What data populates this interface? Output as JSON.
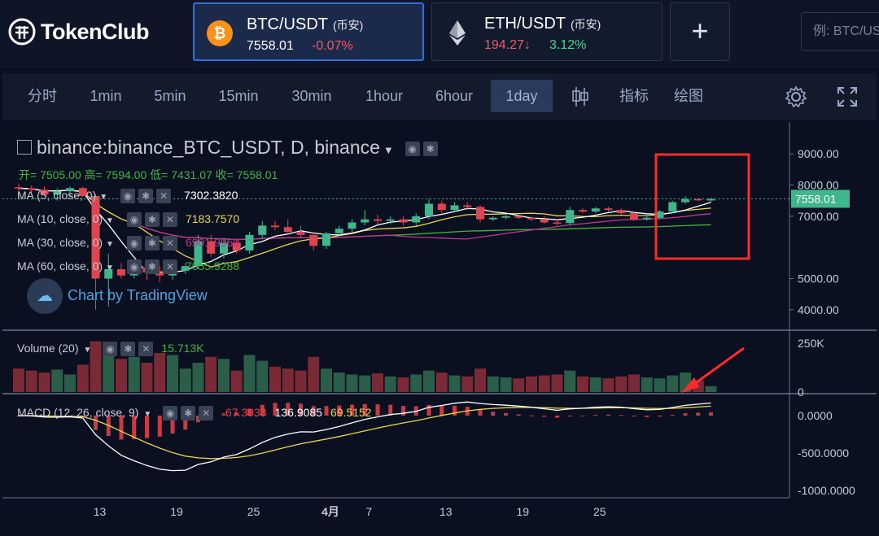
{
  "brand": {
    "name": "TokenClub"
  },
  "pairs": [
    {
      "name": "BTC/USDT",
      "exchange": "(币安)",
      "price": "7558.01",
      "change": "-0.07%",
      "change_color": "#f05a61",
      "coin_color": "#f7931a"
    },
    {
      "name": "ETH/USDT",
      "exchange": "(币安)",
      "price": "194.27↓",
      "change": "3.12%",
      "price_color": "#f05a61",
      "change_color": "#3ddc84"
    }
  ],
  "add_label": "+",
  "search": {
    "placeholder": "例: BTC/US"
  },
  "toolbar": {
    "items": [
      "分时",
      "1min",
      "5min",
      "15min",
      "30min",
      "1hour",
      "6hour",
      "1day"
    ],
    "active": "1day",
    "indicators": "指标",
    "draw": "绘图"
  },
  "legend": {
    "symbol": "binance:binance_BTC_USDT, D, binance",
    "ohlc": "开= 7505.00 高= 7594.00 低= 7431.07 收= 7558.01",
    "ma5": {
      "label": "MA (5, close, 0)",
      "value": "7302.3820",
      "color": "#ffffff"
    },
    "ma10": {
      "label": "MA (10, close, 0)",
      "value": "7183.7570",
      "color": "#e8d44d"
    },
    "ma30": {
      "label": "MA (30, close, 0)",
      "value": "6901.9960",
      "color": "#c2348f"
    },
    "ma60": {
      "label": "MA (60, close, 0)",
      "value": "7055.9288",
      "color": "#3fb53f"
    },
    "watermark": "Chart by TradingView",
    "volume": {
      "label": "Volume (20)",
      "value": "15.713K"
    },
    "macd": {
      "label": "MACD (12, 26, close, 9)",
      "hist": "-67.3933",
      "macd": "136.9085",
      "signal": "69.5152"
    }
  },
  "price_axis": [
    "9000.00",
    "8000.00",
    "7000.00",
    "5000.00",
    "4000.00"
  ],
  "price_marker": "7558.01",
  "volume_axis": [
    "250K",
    "0"
  ],
  "macd_axis": [
    "0.0000",
    "-500.0000",
    "-1000.0000"
  ],
  "time_axis": [
    "13",
    "19",
    "25",
    "4月",
    "7",
    "13",
    "19",
    "25"
  ],
  "colors": {
    "up": "#3fb68b",
    "down": "#e0454f",
    "highlight": "#ff2a2a"
  },
  "chart_data": {
    "type": "candlestick",
    "candles": [
      {
        "o": 7930,
        "h": 8050,
        "l": 7700,
        "c": 7900
      },
      {
        "o": 7900,
        "h": 7990,
        "l": 7750,
        "c": 7850
      },
      {
        "o": 7850,
        "h": 7950,
        "l": 7650,
        "c": 7700
      },
      {
        "o": 7700,
        "h": 7900,
        "l": 7500,
        "c": 7800
      },
      {
        "o": 7800,
        "h": 7950,
        "l": 7600,
        "c": 7900
      },
      {
        "o": 7900,
        "h": 7950,
        "l": 7600,
        "c": 7650
      },
      {
        "o": 7650,
        "h": 7700,
        "l": 4000,
        "c": 5000
      },
      {
        "o": 5000,
        "h": 5800,
        "l": 4100,
        "c": 5300
      },
      {
        "o": 5300,
        "h": 5500,
        "l": 5000,
        "c": 5100
      },
      {
        "o": 5100,
        "h": 5600,
        "l": 5000,
        "c": 5350
      },
      {
        "o": 5350,
        "h": 5500,
        "l": 4950,
        "c": 5200
      },
      {
        "o": 5200,
        "h": 5400,
        "l": 4900,
        "c": 5100
      },
      {
        "o": 5100,
        "h": 5300,
        "l": 4950,
        "c": 5250
      },
      {
        "o": 5250,
        "h": 5500,
        "l": 5150,
        "c": 5400
      },
      {
        "o": 5400,
        "h": 6400,
        "l": 5300,
        "c": 6200
      },
      {
        "o": 6200,
        "h": 6400,
        "l": 5700,
        "c": 5800
      },
      {
        "o": 5800,
        "h": 6300,
        "l": 5650,
        "c": 6150
      },
      {
        "o": 6150,
        "h": 6250,
        "l": 5800,
        "c": 5900
      },
      {
        "o": 5900,
        "h": 6500,
        "l": 5800,
        "c": 6400
      },
      {
        "o": 6400,
        "h": 6850,
        "l": 6300,
        "c": 6700
      },
      {
        "o": 6700,
        "h": 6850,
        "l": 6550,
        "c": 6650
      },
      {
        "o": 6650,
        "h": 6900,
        "l": 6400,
        "c": 6500
      },
      {
        "o": 6500,
        "h": 6700,
        "l": 6300,
        "c": 6400
      },
      {
        "o": 6400,
        "h": 6500,
        "l": 5900,
        "c": 6050
      },
      {
        "o": 6050,
        "h": 6500,
        "l": 5950,
        "c": 6450
      },
      {
        "o": 6450,
        "h": 6700,
        "l": 6350,
        "c": 6600
      },
      {
        "o": 6600,
        "h": 6900,
        "l": 6500,
        "c": 6800
      },
      {
        "o": 6800,
        "h": 7200,
        "l": 6700,
        "c": 6900
      },
      {
        "o": 6900,
        "h": 7050,
        "l": 6750,
        "c": 6850
      },
      {
        "o": 6850,
        "h": 7000,
        "l": 6750,
        "c": 6900
      },
      {
        "o": 6900,
        "h": 7000,
        "l": 6700,
        "c": 6800
      },
      {
        "o": 6800,
        "h": 7100,
        "l": 6700,
        "c": 7000
      },
      {
        "o": 7000,
        "h": 7550,
        "l": 6900,
        "c": 7400
      },
      {
        "o": 7400,
        "h": 7500,
        "l": 7100,
        "c": 7200
      },
      {
        "o": 7200,
        "h": 7450,
        "l": 7150,
        "c": 7350
      },
      {
        "o": 7350,
        "h": 7450,
        "l": 7200,
        "c": 7300
      },
      {
        "o": 7300,
        "h": 7350,
        "l": 6800,
        "c": 6900
      },
      {
        "o": 6900,
        "h": 7000,
        "l": 6850,
        "c": 6950
      },
      {
        "o": 6950,
        "h": 7050,
        "l": 6900,
        "c": 7000
      },
      {
        "o": 7000,
        "h": 7050,
        "l": 6900,
        "c": 6950
      },
      {
        "o": 6950,
        "h": 7000,
        "l": 6850,
        "c": 6900
      },
      {
        "o": 6900,
        "h": 7000,
        "l": 6750,
        "c": 6800
      },
      {
        "o": 6800,
        "h": 6900,
        "l": 6700,
        "c": 6780
      },
      {
        "o": 6780,
        "h": 7300,
        "l": 6700,
        "c": 7200
      },
      {
        "o": 7200,
        "h": 7250,
        "l": 7100,
        "c": 7150
      },
      {
        "o": 7150,
        "h": 7300,
        "l": 7100,
        "c": 7250
      },
      {
        "o": 7250,
        "h": 7300,
        "l": 7150,
        "c": 7200
      },
      {
        "o": 7200,
        "h": 7250,
        "l": 7050,
        "c": 7100
      },
      {
        "o": 7100,
        "h": 7150,
        "l": 6850,
        "c": 6900
      },
      {
        "o": 6900,
        "h": 7050,
        "l": 6850,
        "c": 6950
      },
      {
        "o": 6950,
        "h": 7200,
        "l": 6900,
        "c": 7150
      },
      {
        "o": 7150,
        "h": 7500,
        "l": 7100,
        "c": 7450
      },
      {
        "o": 7450,
        "h": 7650,
        "l": 7400,
        "c": 7550
      },
      {
        "o": 7550,
        "h": 7580,
        "l": 7480,
        "c": 7510
      },
      {
        "o": 7505,
        "h": 7594,
        "l": 7431.07,
        "c": 7558.01
      }
    ],
    "volume": [
      120,
      110,
      100,
      115,
      90,
      140,
      260,
      200,
      170,
      180,
      150,
      200,
      190,
      120,
      150,
      180,
      170,
      110,
      190,
      160,
      130,
      120,
      110,
      180,
      120,
      100,
      90,
      85,
      95,
      80,
      75,
      90,
      110,
      100,
      85,
      80,
      120,
      80,
      75,
      70,
      80,
      85,
      90,
      110,
      80,
      75,
      70,
      80,
      90,
      75,
      70,
      85,
      100,
      60,
      30
    ],
    "volume_colors": "up/down by candle",
    "ylim_price": [
      3500,
      9500
    ],
    "ylim_volume": [
      0,
      300
    ],
    "ylim_macd": [
      -1100,
      250
    ]
  }
}
